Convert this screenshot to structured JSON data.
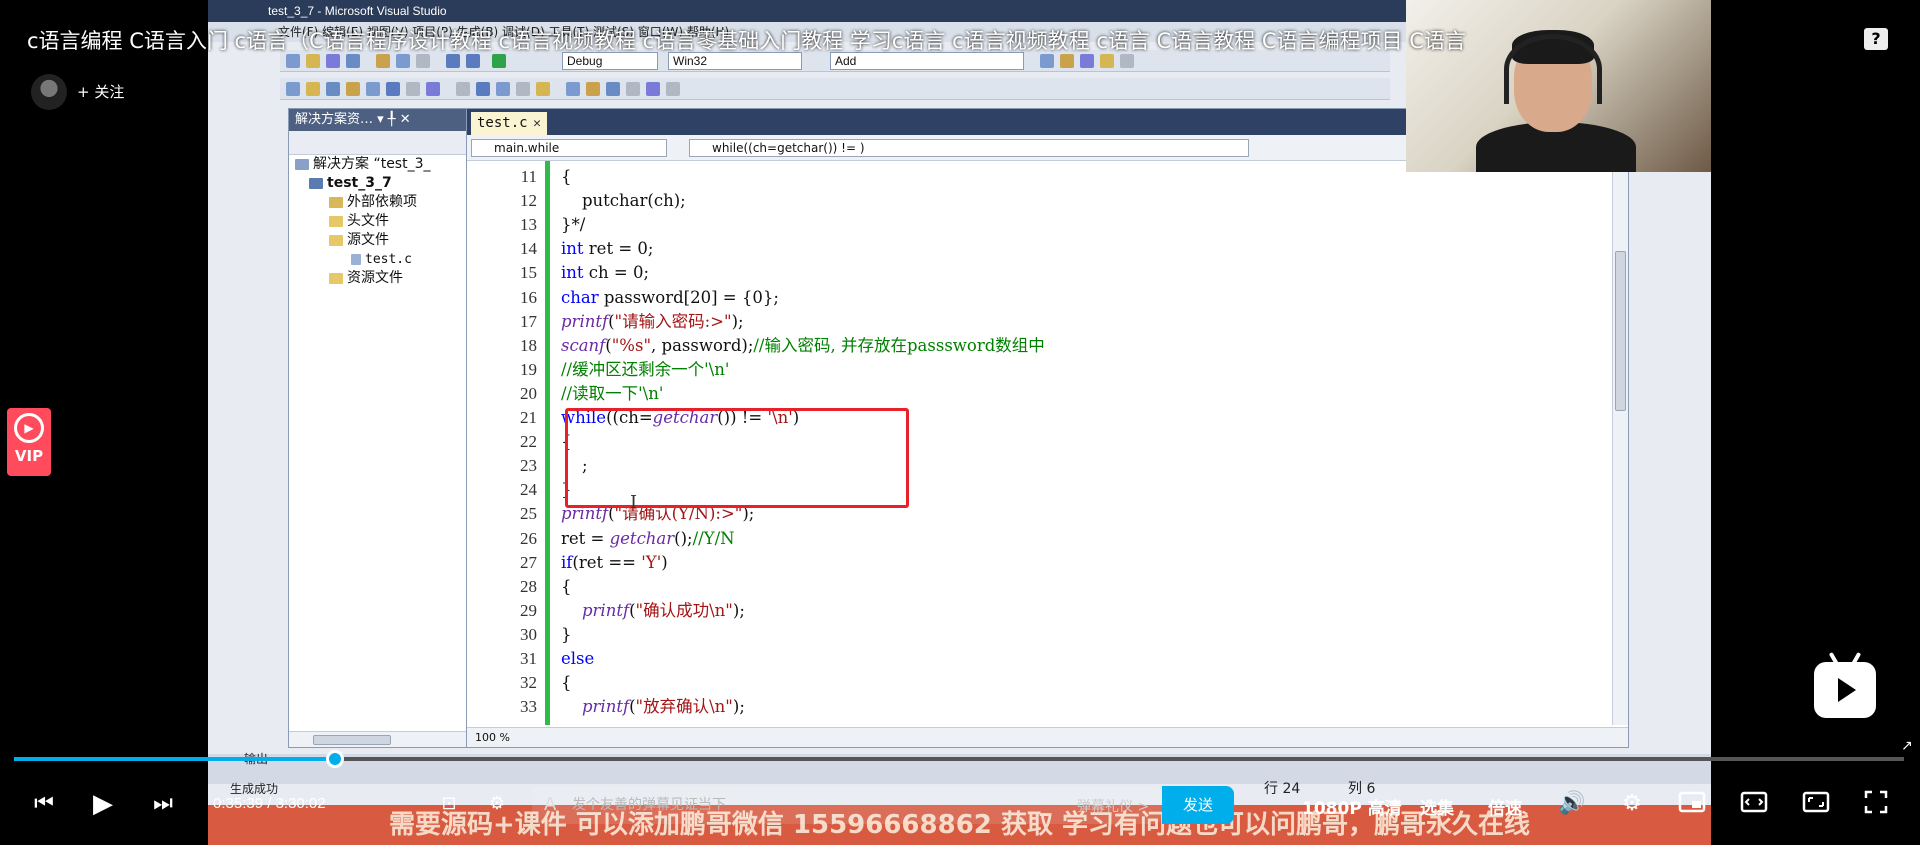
{
  "player": {
    "title": "c语言编程 C语言入门 c语言（C语言程序设计教程 c语言视频教程 c语言零基础入门教程 学习c语言 c语言视频教程 c语言 C语言教程 C语言编程项目 C语言",
    "follow_label": "+ 关注",
    "help_label": "?",
    "vip_label": "VIP",
    "current_time": "0:35:39",
    "separator": "/",
    "total_time": "3:30:02",
    "progress": 0.17,
    "danmaku_placeholder": "发个友善的弹幕见证当下",
    "danmaku_etiquette": "弹幕礼仪 >",
    "send_label": "发送",
    "quality_label": "1080P 高清",
    "episodes_label": "选集",
    "speed_label": "倍速",
    "accent_color": "#00aeec"
  },
  "video": {
    "vs_title": "test_3_7 - Microsoft Visual Studio",
    "menu_text": "文件(F)  编辑(E)  视图(V)  项目(P)  生成(B)  调试(D)  工具(T)  测试(S)  窗口(W)  帮助(H)",
    "config_combo": "Debug",
    "platform_combo": "Win32",
    "find_combo": "Add",
    "solution_panel_title": "解决方案资… ▾ ╀ ✕",
    "tree": [
      "解决方案 “test_3_",
      "test_3_7",
      "外部依赖项",
      "头文件",
      "源文件",
      "test.c",
      "资源文件"
    ],
    "tab_label": "test.c",
    "nav_scope": "main.while",
    "nav_member": "while((ch=getchar()) != )",
    "zoom": "100 %",
    "status_left": "生成成功",
    "output_tab": "输出",
    "status_line": "行 24",
    "status_col": "列 6",
    "banner_text": "需要源码+课件 可以添加鹏哥微信 15596668862 获取 学习有问题也可以问鹏哥，鹏哥永久在线",
    "highlight_color": "#e8202a"
  },
  "code": [
    {
      "n": "11",
      "t": "{"
    },
    {
      "n": "12",
      "t": "    putchar(ch);"
    },
    {
      "n": "13",
      "t": "}*/"
    },
    {
      "n": "14",
      "t": "int ret = 0;"
    },
    {
      "n": "15",
      "t": "int ch = 0;"
    },
    {
      "n": "16",
      "t": "char password[20] = {0};"
    },
    {
      "n": "17",
      "t": "printf(\"请输入密码:>\");"
    },
    {
      "n": "18",
      "t": "scanf(\"%s\", password);//输入密码, 并存放在passsword数组中"
    },
    {
      "n": "19",
      "t": "//缓冲区还剩余一个'\\n'"
    },
    {
      "n": "20",
      "t": "//读取一下'\\n'"
    },
    {
      "n": "21",
      "t": "while((ch=getchar()) != '\\n')"
    },
    {
      "n": "22",
      "t": "{"
    },
    {
      "n": "23",
      "t": "    ;"
    },
    {
      "n": "24",
      "t": "}"
    },
    {
      "n": "25",
      "t": "printf(\"请确认(Y/N):>\");"
    },
    {
      "n": "26",
      "t": "ret = getchar();//Y/N"
    },
    {
      "n": "27",
      "t": "if(ret == 'Y')"
    },
    {
      "n": "28",
      "t": "{"
    },
    {
      "n": "29",
      "t": "    printf(\"确认成功\\n\");"
    },
    {
      "n": "30",
      "t": "}"
    },
    {
      "n": "31",
      "t": "else"
    },
    {
      "n": "32",
      "t": "{"
    },
    {
      "n": "33",
      "t": "    printf(\"放弃确认\\n\");"
    }
  ]
}
